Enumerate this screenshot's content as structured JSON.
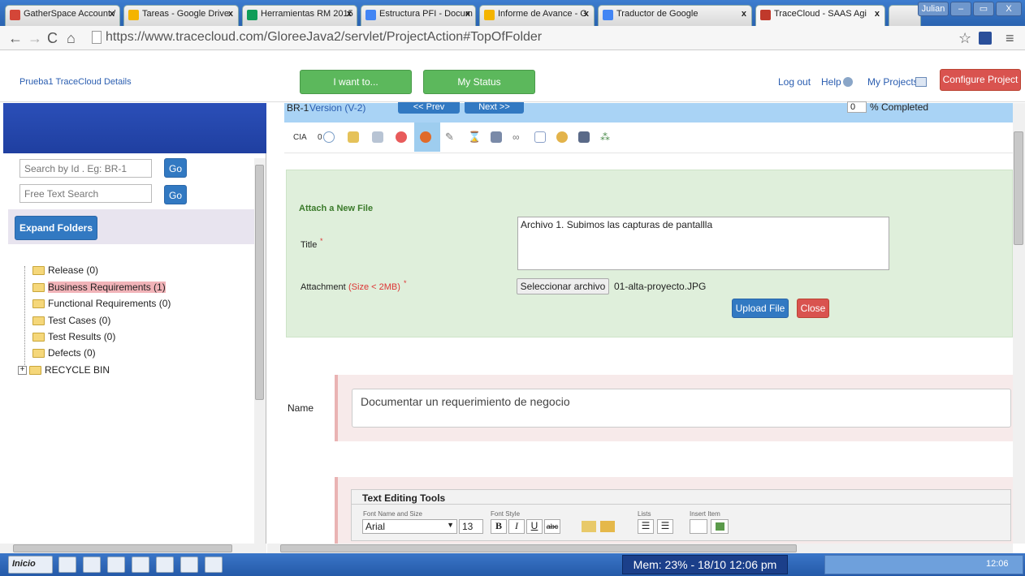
{
  "browser": {
    "tabs": [
      {
        "label": "GatherSpace Account /",
        "color": "#d44638"
      },
      {
        "label": "Tareas - Google Drive",
        "color": "#f4b400"
      },
      {
        "label": "Herramientas RM 2015",
        "color": "#0f9d58"
      },
      {
        "label": "Estructura PFI - Docum",
        "color": "#4285f4"
      },
      {
        "label": "Informe de Avance - G",
        "color": "#f4b400"
      },
      {
        "label": "Traductor de Google",
        "color": "#4285f4"
      },
      {
        "label": "TraceCloud - SAAS Agi",
        "color": "#c0392b"
      }
    ],
    "user": "Julian",
    "url": "https://www.tracecloud.com/GloreeJava2/servlet/ProjectAction#TopOfFolder"
  },
  "header": {
    "project_link": "Prueba1 TraceCloud Details",
    "i_want_to": "I want to...",
    "my_status": "My Status",
    "log_out": "Log out",
    "help": "Help",
    "my_projects": "My Projects",
    "configure_project": "Configure Project"
  },
  "sidebar": {
    "search_id_placeholder": "Search by Id . Eg: BR-1",
    "free_text_placeholder": "Free Text Search",
    "go": "Go",
    "expand_folders": "Expand Folders",
    "folders": [
      {
        "label": "Release (0)"
      },
      {
        "label": "Business Requirements (1)",
        "selected": true
      },
      {
        "label": "Functional Requirements (0)"
      },
      {
        "label": "Test Cases (0)"
      },
      {
        "label": "Test Results (0)"
      },
      {
        "label": "Defects (0)"
      }
    ],
    "recycle_bin": "RECYCLE BIN"
  },
  "requirement": {
    "id": "BR-1",
    "version": "Version (V-2)",
    "prev": "<< Prev",
    "next": "Next >>",
    "percent": "0",
    "percent_label": "% Completed",
    "cia": "CIA",
    "comment_count": "0"
  },
  "attach": {
    "heading": "Attach a New File",
    "title_label": "Title",
    "title_value": "Archivo 1. Subimos las capturas de pantallla",
    "attachment_label": "Attachment",
    "size_note": "(Size < 2MB)",
    "required_mark": "*",
    "choose_button": "Seleccionar archivo",
    "file_name": "01-alta-proyecto.JPG",
    "upload": "Upload File",
    "close": "Close"
  },
  "form": {
    "name_label": "Name",
    "name_value": "Documentar un requerimiento de negocio",
    "text_tools_heading": "Text Editing Tools",
    "font_name_size": "Font Name and Size",
    "font_style": "Font Style",
    "lists": "Lists",
    "insert_item": "Insert Item",
    "font": "Arial",
    "font_size": "13"
  },
  "taskbar": {
    "start": "Inicio",
    "memory": "Mem: 23% - 18/10  12:06 pm",
    "clock": "12:06"
  }
}
